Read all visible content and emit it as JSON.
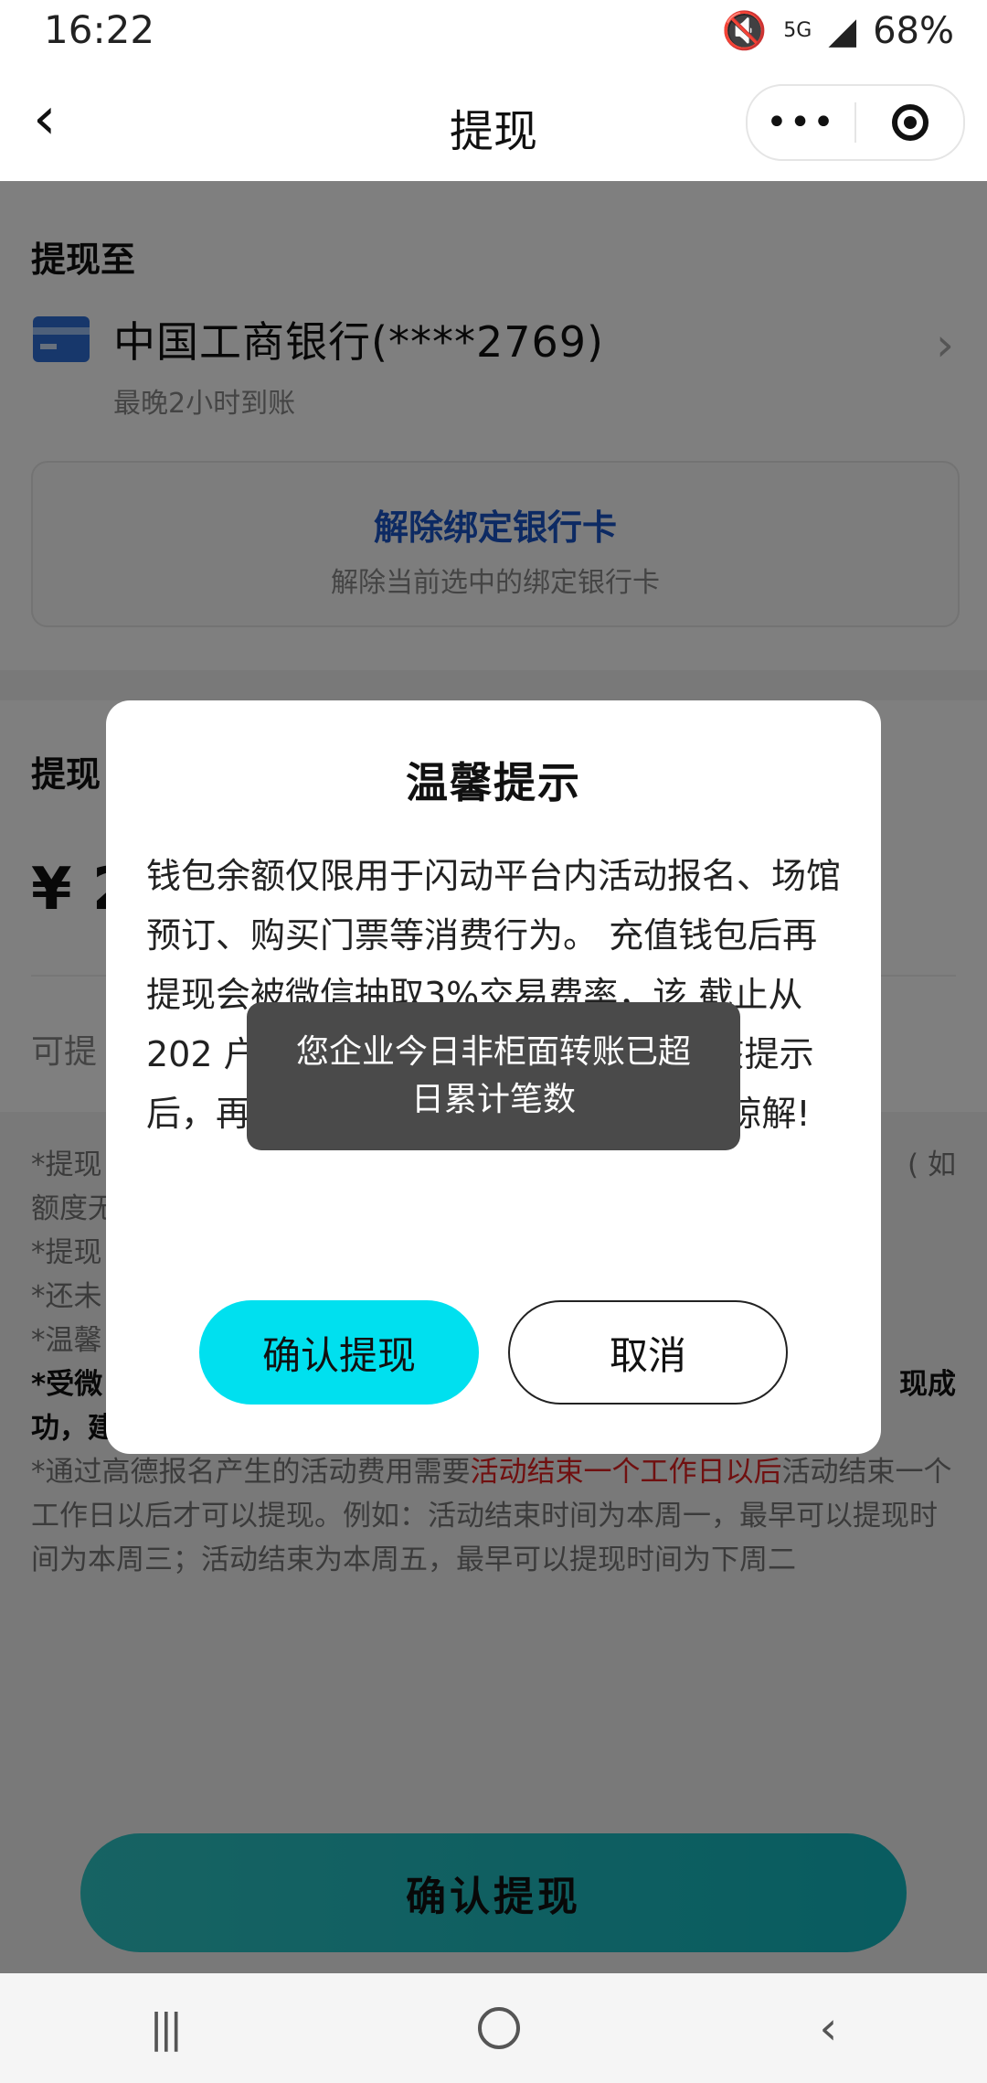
{
  "status_bar": {
    "time": "16:22",
    "signal": "5G",
    "battery": "68%"
  },
  "nav": {
    "back_icon": "‹",
    "title": "提现",
    "more_icon": "•••"
  },
  "withdraw_to": {
    "label": "提现至",
    "bank_name": "中国工商银行(****2769)",
    "arrival": "最晚2小时到账",
    "unbind_title": "解除绑定银行卡",
    "unbind_sub": "解除当前选中的绑定银行卡"
  },
  "amount": {
    "label": "提现",
    "currency_prefix": "¥ 2",
    "available_label": "可提"
  },
  "notes": {
    "line1": "*提现",
    "line1_end": "( 如",
    "line2": "额度无",
    "line3": "*提现",
    "line4": "*还未",
    "line5": "*温馨",
    "line6_start": "*受微",
    "line6_end": "现成",
    "line7": "功，建",
    "gaode_pre": "*通过高德报名产生的活动费用需要",
    "gaode_red": "活动结束一个工作日以后",
    "gaode_post": "活动结束一个工作日以后才可以提现。例如：活动结束时间为本周一，最早可以提现时间为本周三；活动结束为本周五，最早可以提现时间为下周二"
  },
  "bottom_button": "确认提现",
  "dialog": {
    "title": "温馨提示",
    "body": "钱包余额仅限用于闪动平台内活动报名、场馆预订、购买门票等消费行为。 充值钱包后再提现会被微信抽取3%交易费率，该 截止从202 户提现时自行承担，请认真阅读该提示后，再确认是否考虑提现! 带来不便请谅解!",
    "confirm": "确认提现",
    "cancel": "取消"
  },
  "toast": "您企业今日非柜面转账已超日累计笔数"
}
